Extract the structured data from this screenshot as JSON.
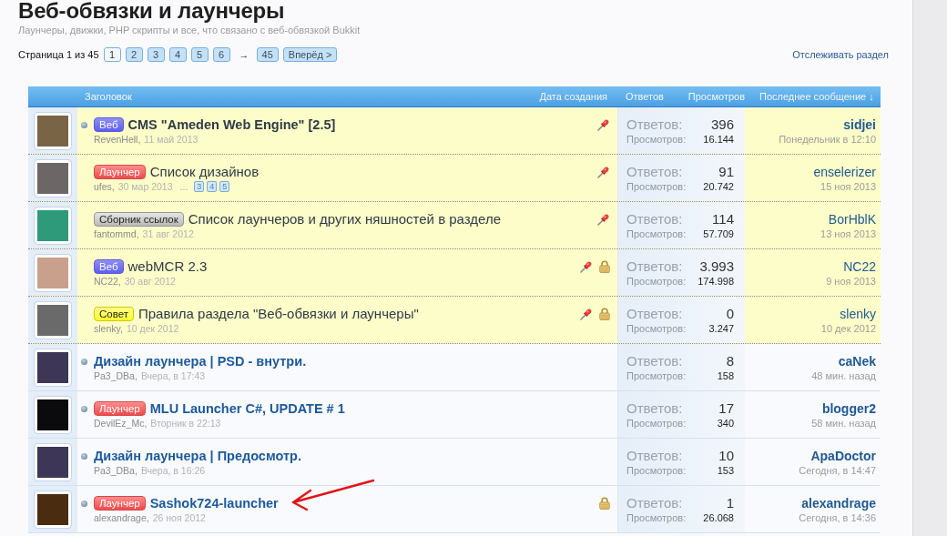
{
  "section": {
    "title": "Веб-обвязки и лаунчеры",
    "description": "Лаунчеры, движки, PHP скрипты и все, что связано с веб-обвязкой Bukkit"
  },
  "page_nav": {
    "label": "Страница 1 из 45",
    "pages": [
      {
        "label": "1",
        "selected": true
      },
      {
        "label": "2",
        "selected": false
      },
      {
        "label": "3",
        "selected": false
      },
      {
        "label": "4",
        "selected": false
      },
      {
        "label": "5",
        "selected": false
      },
      {
        "label": "6",
        "selected": false
      }
    ],
    "jump": "→",
    "last_page": {
      "label": "45",
      "selected": false
    },
    "next": "Вперёд >",
    "watch_link": "Отслеживать раздел"
  },
  "table": {
    "columns": [
      "Заголовок",
      "Дата создания",
      "Ответов",
      "Просмотров",
      "Последнее сообщение ↓"
    ]
  },
  "threads": [
    {
      "avatar": {
        "color": "#7a6446"
      },
      "prefix": {
        "label": "Веб",
        "kind": "web"
      },
      "title": "CMS \"Ameden Web Engine\" [2.5]",
      "author": "RevenHell,",
      "date": "11 май 2013",
      "unread": true,
      "sticky": true,
      "locked": false,
      "marked": false,
      "replies_label": "Ответов:",
      "replies": "396",
      "views_label": "Просмотров:",
      "views": "16.144",
      "last_poster": "sidjei",
      "last_date": "Понедельник в 12:10"
    },
    {
      "avatar": {
        "color": "#6c6666"
      },
      "prefix": {
        "label": "Лаунчер",
        "kind": "launcher"
      },
      "title": "Список дизайнов",
      "author": "ufes,",
      "date": "30 мар 2013",
      "ellipsis": "...",
      "page_links": [
        "3",
        "4",
        "5"
      ],
      "unread": false,
      "sticky": true,
      "locked": false,
      "marked": false,
      "replies_label": "Ответов:",
      "replies": "91",
      "views_label": "Просмотров:",
      "views": "20.742",
      "last_poster": "enselerizer",
      "last_date": "15 ноя 2013"
    },
    {
      "avatar": {
        "color": "#2e9a7a"
      },
      "prefix": {
        "label": "Сборник ссылок",
        "kind": "links"
      },
      "title": "Список лаунчеров и других няшностей в разделе",
      "author": "fantommd,",
      "date": "31 авг 2012",
      "unread": false,
      "sticky": true,
      "locked": false,
      "marked": false,
      "replies_label": "Ответов:",
      "replies": "114",
      "views_label": "Просмотров:",
      "views": "57.709",
      "last_poster": "BorHblK",
      "last_date": "13 ноя 2013"
    },
    {
      "avatar": {
        "color": "#c9a08c"
      },
      "prefix": {
        "label": "Веб",
        "kind": "web"
      },
      "title": "webMCR 2.3",
      "author": "NC22,",
      "date": "30 авг 2012",
      "unread": false,
      "sticky": true,
      "locked": true,
      "marked": false,
      "replies_label": "Ответов:",
      "replies": "3.993",
      "views_label": "Просмотров:",
      "views": "174.998",
      "last_poster": "NC22",
      "last_date": "9 ноя 2013"
    },
    {
      "avatar": {
        "color": "#6a6a6a"
      },
      "prefix": {
        "label": "Совет",
        "kind": "tip"
      },
      "title": "Правила раздела \"Веб-обвязки и лаунчеры\"",
      "author": "slenky,",
      "date": "10 дек 2012",
      "unread": false,
      "sticky": true,
      "locked": true,
      "marked": false,
      "replies_label": "Ответов:",
      "replies": "0",
      "views_label": "Просмотров:",
      "views": "3.247",
      "last_poster": "slenky",
      "last_date": "10 дек 2012"
    },
    {
      "avatar": {
        "color": "#3d3656"
      },
      "title": "Дизайн лаунчера | PSD - внутри.",
      "author": "Pa3_DBa,",
      "date": "Вчера, в 17:43",
      "unread": true,
      "sticky": false,
      "locked": false,
      "marked": false,
      "replies_label": "Ответов:",
      "replies": "8",
      "views_label": "Просмотров:",
      "views": "158",
      "last_poster": "caNek",
      "last_date": "48 мин. назад"
    },
    {
      "avatar": {
        "color": "#0b0b0d"
      },
      "prefix": {
        "label": "Лаунчер",
        "kind": "launcher"
      },
      "title": "MLU Launcher C#, UPDATE # 1",
      "author": "DevilEz_Mc,",
      "date": "Вторник в 22:13",
      "unread": true,
      "sticky": false,
      "locked": false,
      "marked": false,
      "replies_label": "Ответов:",
      "replies": "17",
      "views_label": "Просмотров:",
      "views": "340",
      "last_poster": "blogger2",
      "last_date": "58 мин. назад"
    },
    {
      "avatar": {
        "color": "#3d3656"
      },
      "title": "Дизайн лаунчера | Предосмотр.",
      "author": "Pa3_DBa,",
      "date": "Вчера, в 16:26",
      "unread": true,
      "sticky": false,
      "locked": false,
      "marked": false,
      "replies_label": "Ответов:",
      "replies": "10",
      "views_label": "Просмотров:",
      "views": "153",
      "last_poster": "ApaDoctor",
      "last_date": "Сегодня, в 14:47"
    },
    {
      "avatar": {
        "color": "#4a2c10"
      },
      "prefix": {
        "label": "Лаунчер",
        "kind": "launcher"
      },
      "title": "Sashok724-launcher",
      "author": "alexandrage,",
      "date": "26 ноя 2012",
      "unread": true,
      "sticky": false,
      "locked": true,
      "marked": true,
      "replies_label": "Ответов:",
      "replies": "1",
      "views_label": "Просмотров:",
      "views": "26.068",
      "last_poster": "alexandrage",
      "last_date": "Сегодня, в 14:36"
    }
  ]
}
